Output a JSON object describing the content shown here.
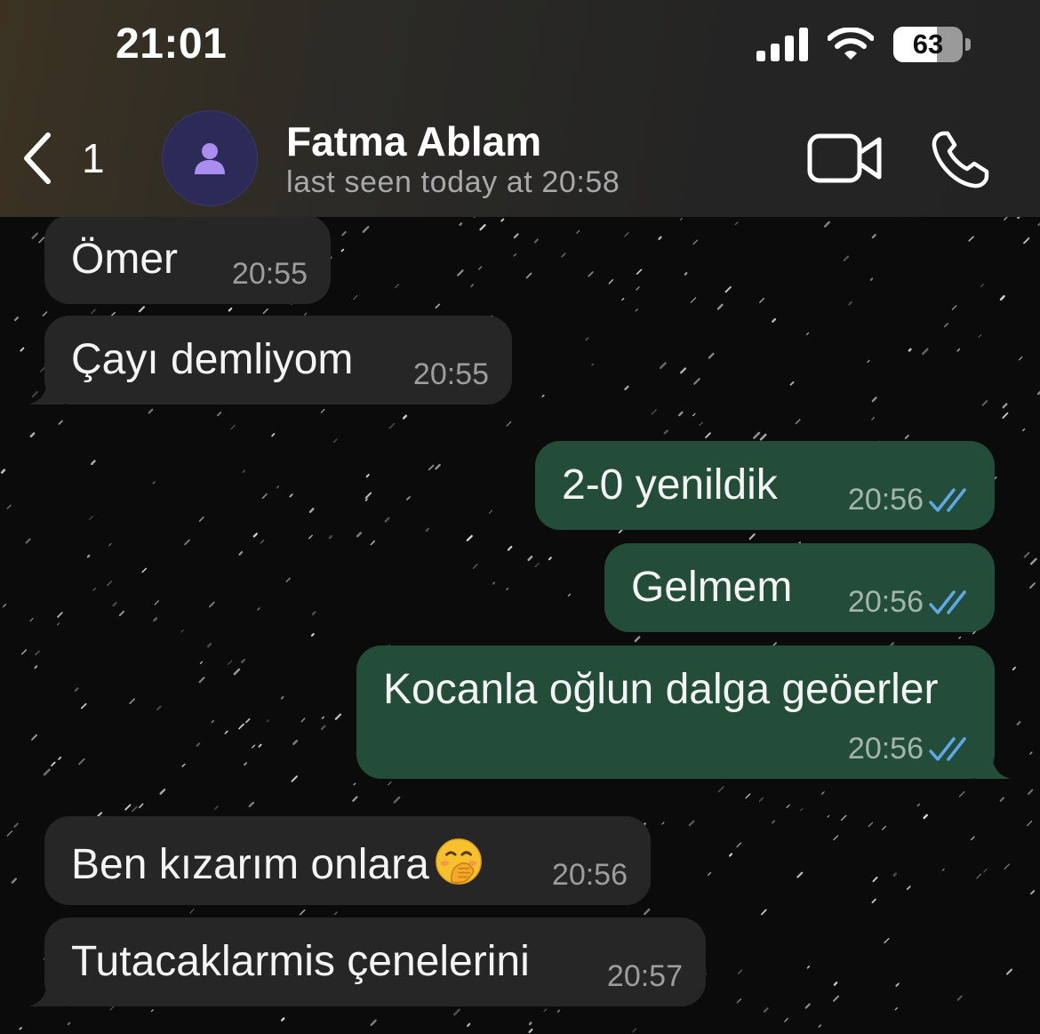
{
  "status_bar": {
    "time": "21:01",
    "battery": "63",
    "battery_level": 0.63
  },
  "header": {
    "back_count": "1",
    "contact_name": "Fatma Ablam",
    "contact_status": "last seen today at 20:58"
  },
  "messages": [
    {
      "direction": "incoming",
      "text": "Ömer",
      "time": "20:55"
    },
    {
      "direction": "incoming",
      "text": "Çayı demliyom",
      "time": "20:55"
    },
    {
      "direction": "outgoing",
      "text": "2-0 yenildik",
      "time": "20:56",
      "status": "read"
    },
    {
      "direction": "outgoing",
      "text": "Gelmem",
      "time": "20:56",
      "status": "read"
    },
    {
      "direction": "outgoing",
      "text": "Kocanla oğlun dalga geöerler",
      "time": "20:56",
      "status": "read"
    },
    {
      "direction": "incoming",
      "text": "Ben kızarım onlara",
      "emoji": "face-with-hand-over-mouth",
      "time": "20:56"
    },
    {
      "direction": "incoming",
      "text": "Tutacaklarmis çenelerini",
      "time": "20:57"
    }
  ],
  "colors": {
    "incoming_bubble": "#262626",
    "outgoing_bubble": "#244d39",
    "read_ticks": "#5fa8e8",
    "avatar_bg": "#2c2a56",
    "avatar_icon": "#a98ef0"
  },
  "icons": [
    "signal-icon",
    "wifi-icon",
    "battery-icon",
    "back-chevron-icon",
    "person-icon",
    "video-call-icon",
    "phone-icon",
    "double-check-icon"
  ]
}
